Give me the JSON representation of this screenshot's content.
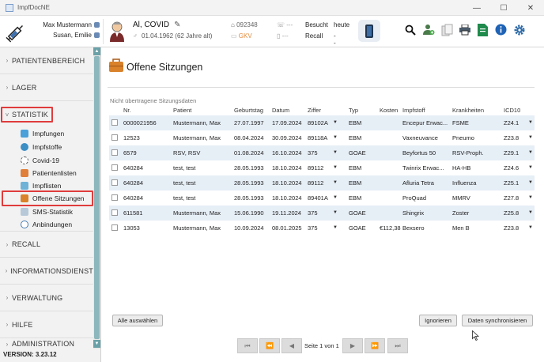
{
  "window": {
    "title": "ImpfDocNE",
    "minimize": "—",
    "maximize": "☐",
    "close": "✕"
  },
  "header": {
    "user_name": "Max Mustermann",
    "user_name_2": "Susan, Emilie",
    "patient_name": "Al, COVID",
    "patient_birth": "01.04.1962",
    "patient_age": "(62 Jahre alt)",
    "patient_id": "092348",
    "insurance": "GKV",
    "phone_placeholder": "---",
    "mobile_placeholder": "---",
    "visit_label": "Besucht",
    "visit_value": "heute",
    "recall_label": "Recall",
    "recall_value": "---",
    "tool_icons": [
      "search-icon",
      "add-user-icon",
      "clipboard-icon",
      "print-icon",
      "document-icon",
      "info-icon",
      "gear-icon"
    ]
  },
  "sidebar": {
    "sections": [
      "PATIENTENBEREICH",
      "LAGER",
      "STATISTIK",
      "RECALL",
      "INFORMATIONSDIENST",
      "VERWALTUNG",
      "HILFE",
      "ADMINISTRATION"
    ],
    "items": [
      "Impfungen",
      "Impfstoffe",
      "Covid-19",
      "Patientenlisten",
      "Impflisten",
      "Offene Sitzungen",
      "SMS-Statistik",
      "Anbindungen"
    ],
    "version": "VERSION: 3.23.12",
    "active_section": "STATISTIK",
    "active_item": "Offene Sitzungen"
  },
  "main": {
    "title": "Offene Sitzungen",
    "caption": "Nicht übertragene Sitzungsdaten",
    "columns": [
      "Nr.",
      "Patient",
      "Geburtstag",
      "Datum",
      "Ziffer",
      "Typ",
      "Kosten",
      "Impfstoff",
      "Krankheiten",
      "ICD10"
    ],
    "rows": [
      [
        "0000021956",
        "Mustermann, Max",
        "27.07.1997",
        "17.09.2024",
        "89102A",
        "EBM",
        "",
        "Encepur Erwac...",
        "FSME",
        "Z24.1"
      ],
      [
        "12523",
        "Mustermann, Max",
        "08.04.2024",
        "30.09.2024",
        "89118A",
        "EBM",
        "",
        "Vaxneuvance",
        "Pneumo",
        "Z23.8"
      ],
      [
        "6579",
        "RSV, RSV",
        "01.08.2024",
        "16.10.2024",
        "375",
        "GOAE",
        "",
        "Beyfortus 50",
        "RSV-Proph.",
        "Z29.1"
      ],
      [
        "640284",
        "test, test",
        "28.05.1993",
        "18.10.2024",
        "89112",
        "EBM",
        "",
        "Twinrix Erwac...",
        "HA-HB",
        "Z24.6"
      ],
      [
        "640284",
        "test, test",
        "28.05.1993",
        "18.10.2024",
        "89112",
        "EBM",
        "",
        "Afluria Tetra",
        "Influenza",
        "Z25.1"
      ],
      [
        "640284",
        "test, test",
        "28.05.1993",
        "18.10.2024",
        "89401A",
        "EBM",
        "",
        "ProQuad",
        "MMRV",
        "Z27.8"
      ],
      [
        "611581",
        "Mustermann, Max",
        "15.06.1990",
        "19.11.2024",
        "375",
        "GOAE",
        "",
        "Shingrix",
        "Zoster",
        "Z25.8"
      ],
      [
        "13053",
        "Mustermann, Max",
        "10.09.2024",
        "08.01.2025",
        "375",
        "GOAE",
        "€112,38",
        "Bexsero",
        "Men B",
        "Z23.8"
      ]
    ],
    "select_all": "Alle auswählen",
    "ignore": "Ignorieren",
    "sync": "Daten synchronisieren",
    "pager_text": "Seite 1 von 1",
    "pager_first": "⏮",
    "pager_prev_fast": "⏪",
    "pager_prev": "◀",
    "pager_next": "▶",
    "pager_next_fast": "⏩",
    "pager_last": "⏭",
    "dropdown_glyph": "▼"
  },
  "colors": {
    "accent": "#e03c3c",
    "row_alt": "#e6eef6",
    "scrollbar": "#8cb7bc"
  }
}
